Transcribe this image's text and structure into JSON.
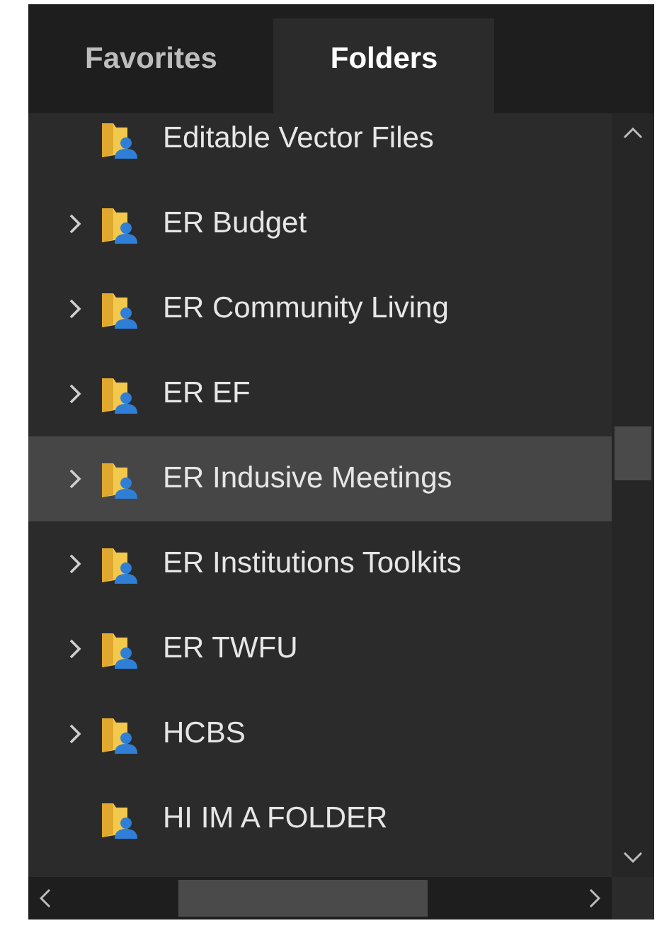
{
  "tabs": [
    {
      "label": "Favorites",
      "selected": false
    },
    {
      "label": "Folders",
      "selected": true
    }
  ],
  "folders": [
    {
      "name": "Editable Vector Files",
      "expandable": false,
      "selected": false
    },
    {
      "name": "ER Budget",
      "expandable": true,
      "selected": false
    },
    {
      "name": "ER Community Living",
      "expandable": true,
      "selected": false
    },
    {
      "name": "ER EF",
      "expandable": true,
      "selected": false
    },
    {
      "name": "ER Indusive Meetings",
      "expandable": true,
      "selected": true
    },
    {
      "name": "ER Institutions Toolkits",
      "expandable": true,
      "selected": false
    },
    {
      "name": "ER TWFU",
      "expandable": true,
      "selected": false
    },
    {
      "name": "HCBS",
      "expandable": true,
      "selected": false
    },
    {
      "name": "HI IM A FOLDER",
      "expandable": false,
      "selected": false
    }
  ]
}
